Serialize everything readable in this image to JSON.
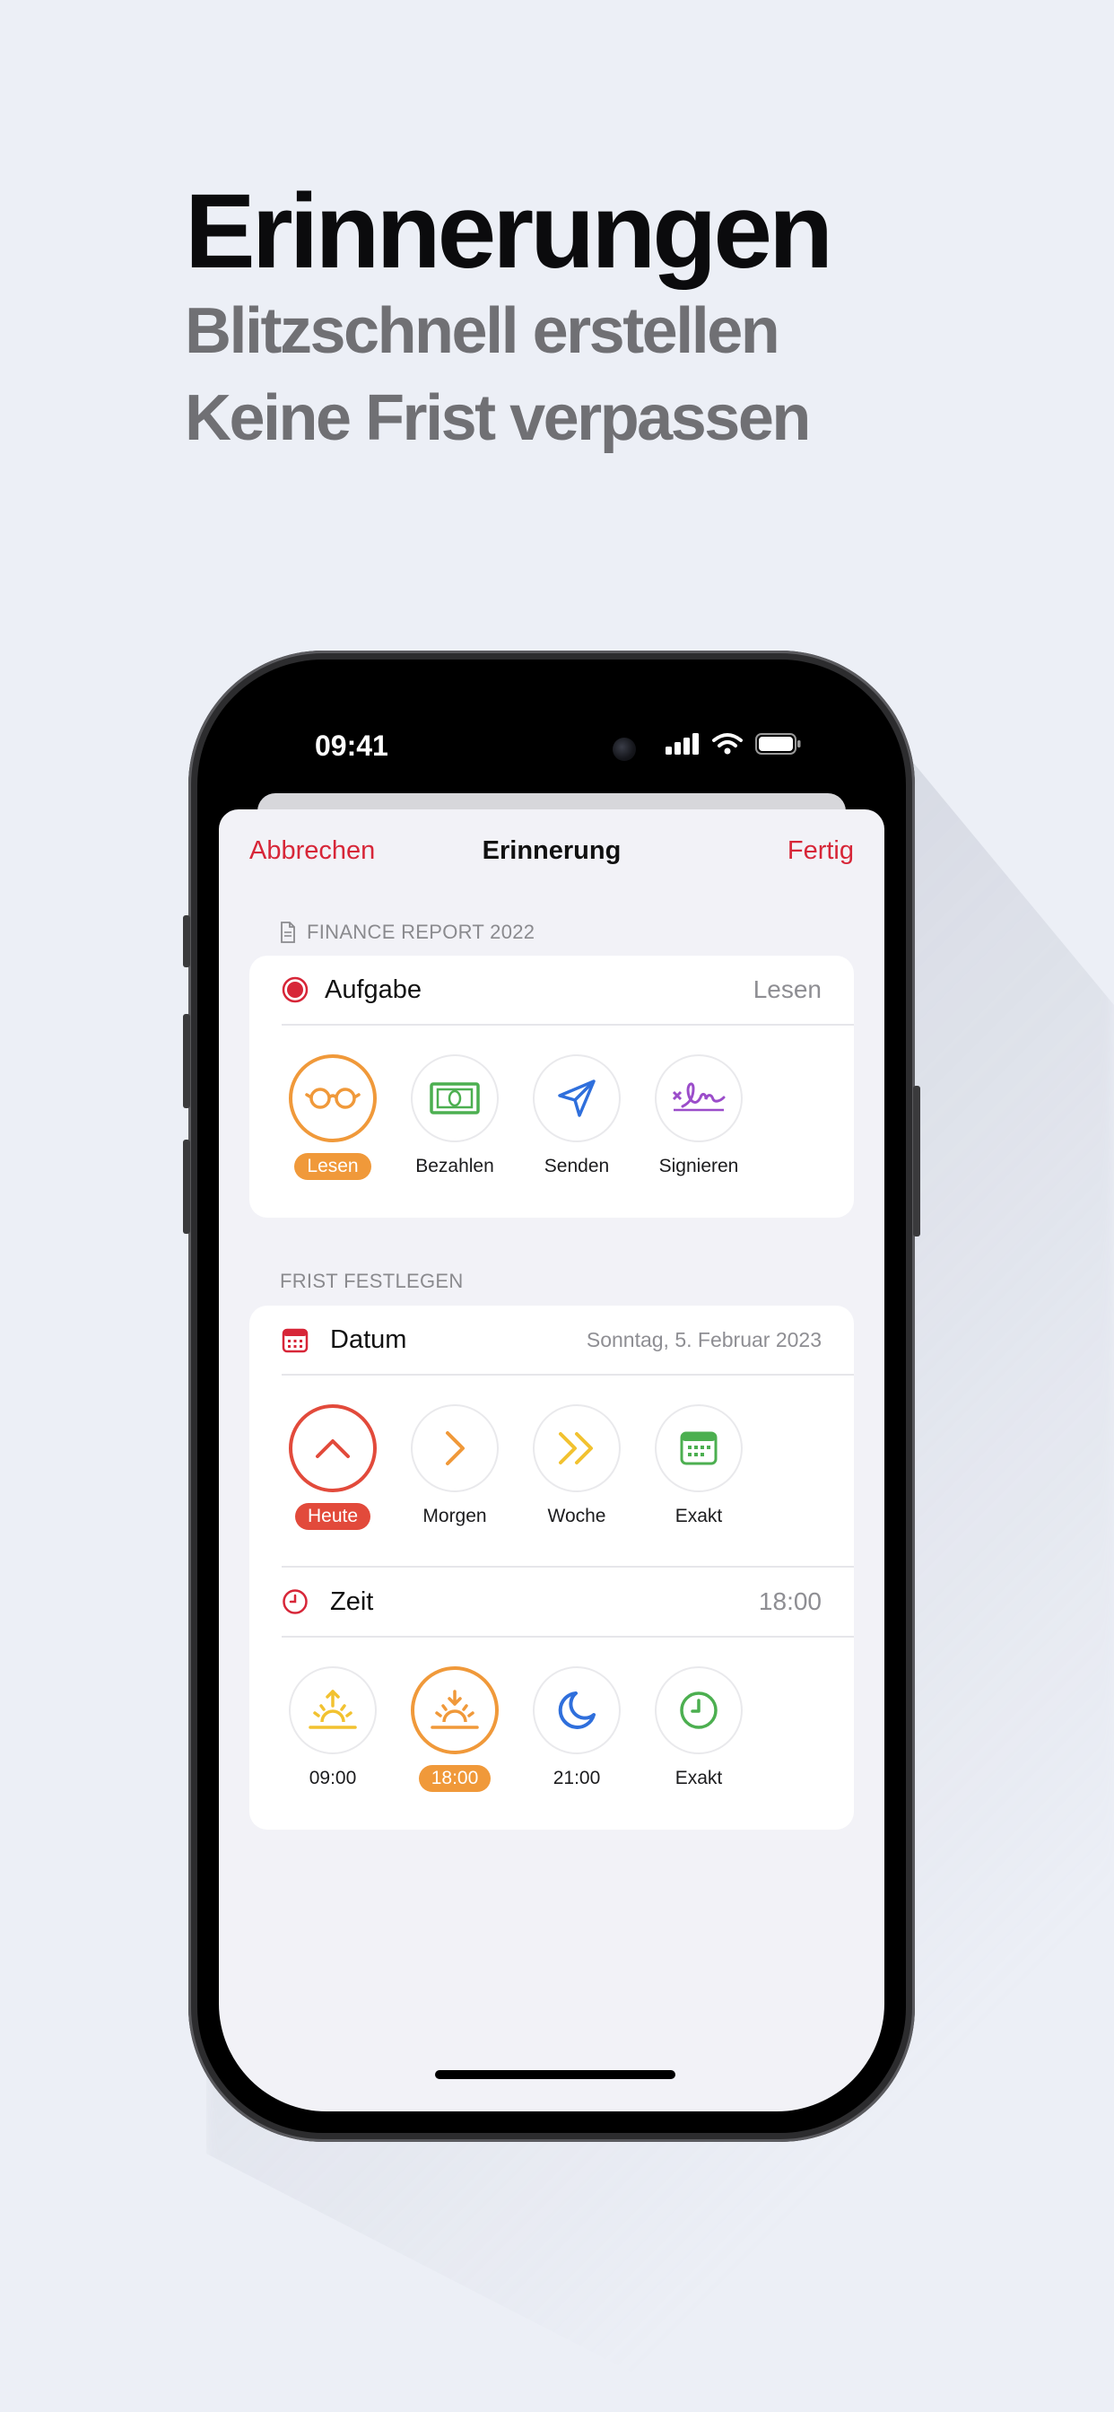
{
  "hero": {
    "title": "Erinnerungen",
    "subtitle_line1": "Blitzschnell erstellen",
    "subtitle_line2": "Keine Frist verpassen"
  },
  "status_bar": {
    "time": "09:41"
  },
  "nav": {
    "cancel_label": "Abbrechen",
    "title": "Erinnerung",
    "done_label": "Fertig"
  },
  "task_section": {
    "header": "FINANCE REPORT 2022",
    "row_label": "Aufgabe",
    "row_value": "Lesen",
    "options": [
      {
        "label": "Lesen",
        "icon": "glasses-icon",
        "selected": true
      },
      {
        "label": "Bezahlen",
        "icon": "banknote-icon",
        "selected": false
      },
      {
        "label": "Senden",
        "icon": "send-icon",
        "selected": false
      },
      {
        "label": "Signieren",
        "icon": "signature-icon",
        "selected": false
      }
    ]
  },
  "deadline_section": {
    "header": "FRIST FESTLEGEN",
    "date_label": "Datum",
    "date_value": "Sonntag, 5. Februar 2023",
    "date_options": [
      {
        "label": "Heute",
        "icon": "chevron-up-icon",
        "selected": true
      },
      {
        "label": "Morgen",
        "icon": "chevron-right-icon",
        "selected": false
      },
      {
        "label": "Woche",
        "icon": "double-chevron-right-icon",
        "selected": false
      },
      {
        "label": "Exakt",
        "icon": "calendar-icon",
        "selected": false
      }
    ],
    "time_label": "Zeit",
    "time_value": "18:00",
    "time_options": [
      {
        "label": "09:00",
        "icon": "sunrise-icon",
        "selected": false
      },
      {
        "label": "18:00",
        "icon": "sunset-icon",
        "selected": true
      },
      {
        "label": "21:00",
        "icon": "moon-icon",
        "selected": false
      },
      {
        "label": "Exakt",
        "icon": "clock-icon",
        "selected": false
      }
    ]
  },
  "colors": {
    "accent_red": "#d72638",
    "selected_orange": "#f0993a",
    "selected_red": "#e24a3b",
    "background": "#eceff6",
    "sheet": "#f2f2f7"
  }
}
